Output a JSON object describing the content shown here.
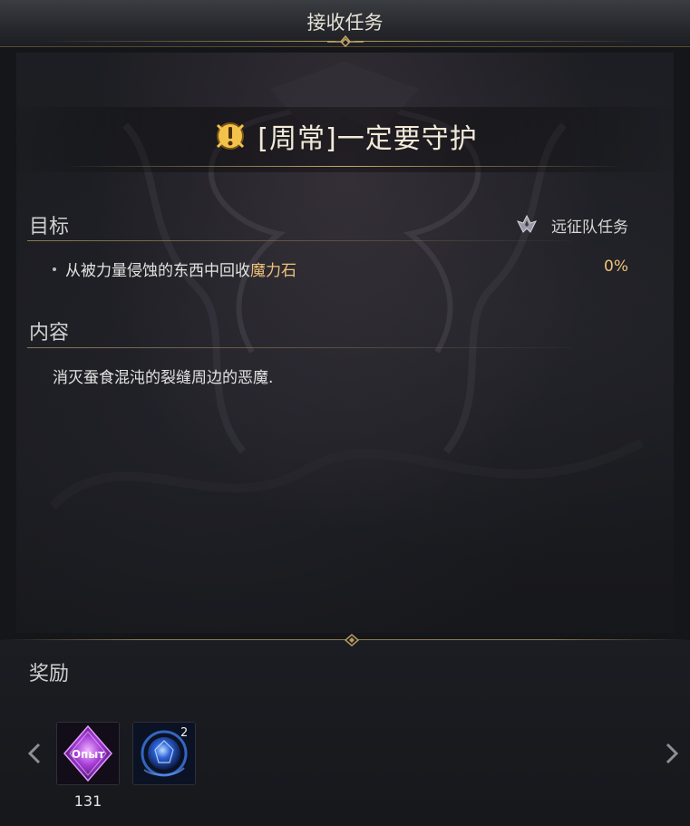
{
  "window": {
    "title": "接收任务"
  },
  "quest": {
    "title": "[周常]一定要守护",
    "icon": "exclamation-quest-icon"
  },
  "objective_section": {
    "header": "目标",
    "quest_type": "远征队任务",
    "quest_type_icon": "expedition-emblem-icon",
    "objective_prefix": "从被力量侵蚀的东西中回收",
    "objective_highlight": "魔力石",
    "progress": "0%"
  },
  "content_section": {
    "header": "内容",
    "text": "消灭蚕食混沌的裂缝周边的恶魔."
  },
  "reward_section": {
    "header": "奖励",
    "items": [
      {
        "name": "exp-reward",
        "icon": "exp-crystal-icon",
        "label": "Опыт",
        "count": "131"
      },
      {
        "name": "gem-reward",
        "icon": "blue-gem-icon",
        "badge": "2"
      }
    ]
  },
  "colors": {
    "accent_gold": "#c7a867",
    "highlight_text": "#f0c27a",
    "exp_purple": "#a43bd6",
    "gem_blue": "#2d63d8"
  }
}
